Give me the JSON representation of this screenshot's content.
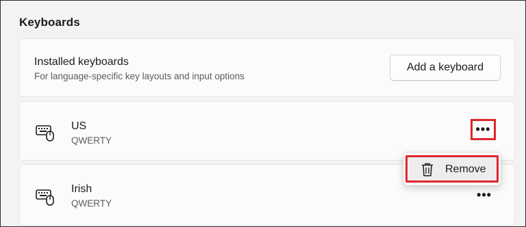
{
  "section": {
    "title": "Keyboards"
  },
  "installed": {
    "title": "Installed keyboards",
    "subtitle": "For language-specific key layouts and input options",
    "add_button_label": "Add a keyboard"
  },
  "keyboards": [
    {
      "name": "US",
      "layout": "QWERTY",
      "icon": "keyboard-mouse-icon",
      "more_icon": "more-options-icon"
    },
    {
      "name": "Irish",
      "layout": "QWERTY",
      "icon": "keyboard-mouse-icon",
      "more_icon": "more-options-icon"
    }
  ],
  "context_menu": {
    "items": [
      {
        "label": "Remove",
        "icon": "trash-icon"
      }
    ]
  },
  "highlight_color": "#e0262b",
  "more_glyph": "•••"
}
